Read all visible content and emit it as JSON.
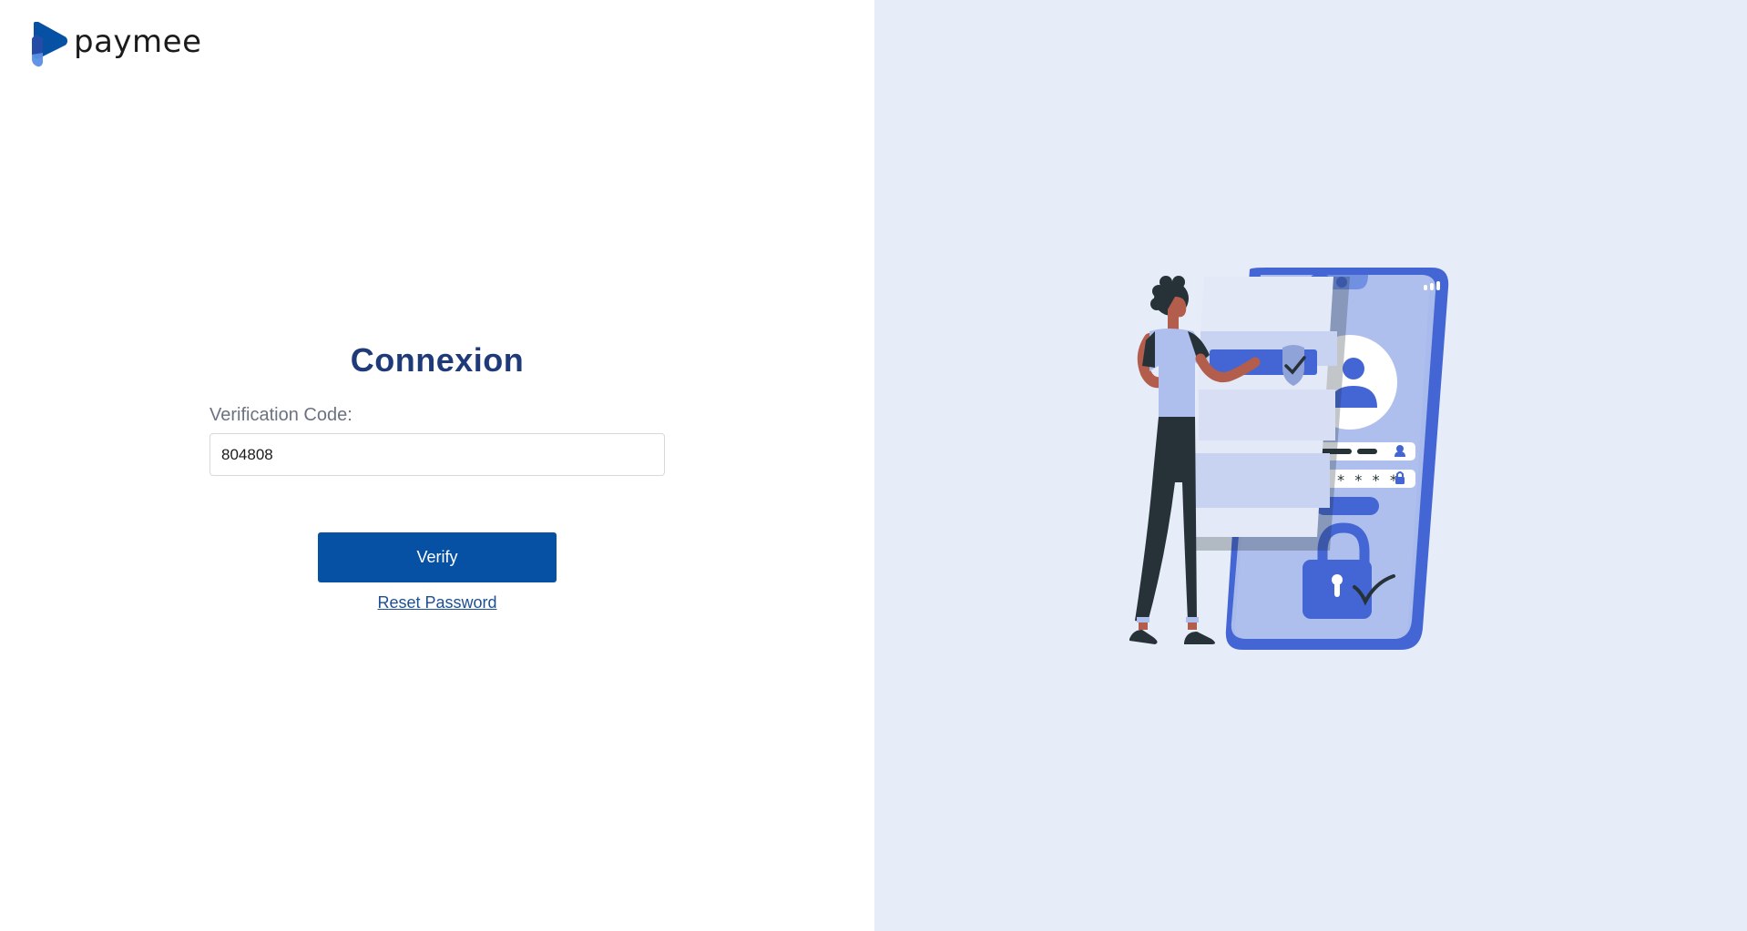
{
  "brand": {
    "name": "paymee",
    "colors": {
      "primary": "#0751a4",
      "title": "#1f3a78",
      "link": "#1d4f91",
      "panel": "#e7edf8",
      "illustration_accent": "#4366d4"
    }
  },
  "login": {
    "title": "Connexion",
    "code_label": "Verification Code:",
    "code_value": "804808",
    "verify_label": "Verify",
    "reset_label": "Reset Password"
  },
  "illustration": {
    "password_mask": "* * * * *"
  }
}
